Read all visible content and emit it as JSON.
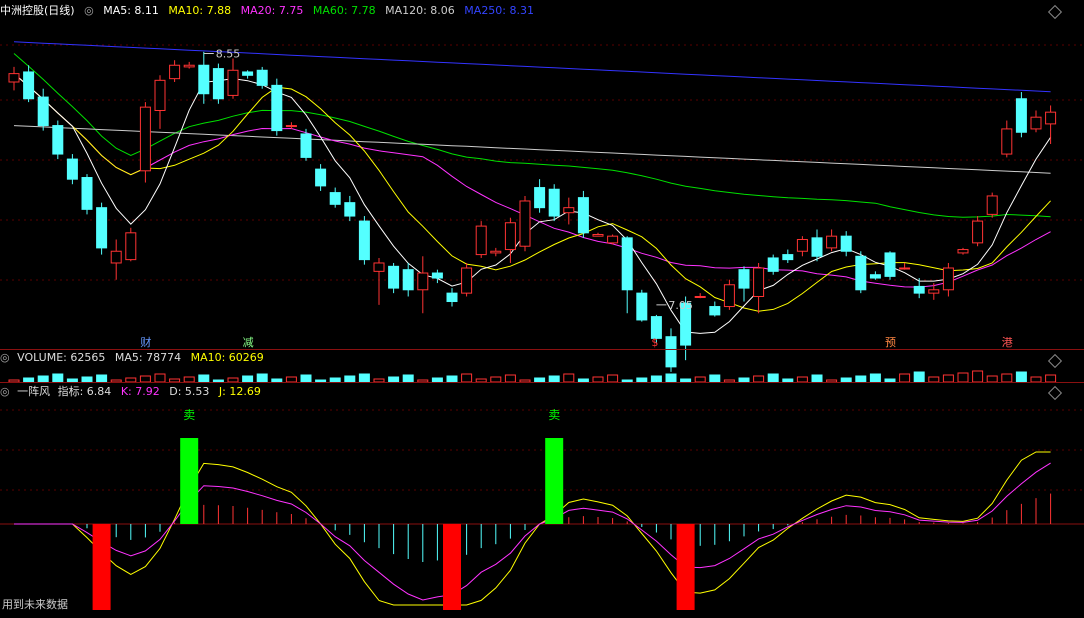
{
  "header": {
    "stock_name": "中洲控股",
    "period": "(日线)",
    "ma5": "MA5: 8.11",
    "ma10": "MA10: 7.88",
    "ma20": "MA20: 7.75",
    "ma60": "MA60: 7.78",
    "ma120": "MA120: 8.06",
    "ma250": "MA250: 8.31"
  },
  "volume_header": {
    "label": "VOLUME: 62565",
    "ma5": "MA5: 78774",
    "ma10": "MA10: 60269"
  },
  "indicator_header": {
    "name": "一阵风",
    "zhibiao": "指标: 6.84",
    "k": "K: 7.92",
    "d": "D: 5.53",
    "j": "J: 12.69"
  },
  "footer": {
    "text": "用到未来数据"
  },
  "colors": {
    "up": "#ff3333",
    "down": "#54ffff",
    "ma5": "#ffffff",
    "ma10": "#ffff00",
    "ma20": "#ff33ff",
    "ma60": "#00e000",
    "ma120": "#cccccc",
    "ma250": "#3333ff",
    "buy_bar": "#ff0000",
    "sell_bar": "#00ff00"
  },
  "chart_data": {
    "type": "candlestick",
    "price_range": [
      6.9,
      8.75
    ],
    "grid": true,
    "price_annotations": [
      {
        "index": 13,
        "value": 8.55,
        "label": "8.55"
      },
      {
        "index": 44,
        "value": 7.05,
        "label": "7.05"
      }
    ],
    "event_markers": [
      {
        "index": 9,
        "text": "财",
        "color": "#6699ff"
      },
      {
        "index": 16,
        "text": "减",
        "color": "#88ff88"
      },
      {
        "index": 44,
        "text": "$",
        "color": "#ff3333"
      },
      {
        "index": 60,
        "text": "预",
        "color": "#ff8844"
      },
      {
        "index": 68,
        "text": "港",
        "color": "#ff5555"
      }
    ],
    "candles": [
      [
        8.38,
        8.47,
        8.33,
        8.43
      ],
      [
        8.44,
        8.48,
        8.26,
        8.28
      ],
      [
        8.29,
        8.34,
        8.09,
        8.12
      ],
      [
        8.12,
        8.15,
        7.92,
        7.95
      ],
      [
        7.92,
        7.95,
        7.77,
        7.8
      ],
      [
        7.81,
        7.83,
        7.59,
        7.62
      ],
      [
        7.63,
        7.66,
        7.35,
        7.39
      ],
      [
        7.3,
        7.44,
        7.2,
        7.37
      ],
      [
        7.32,
        7.51,
        7.31,
        7.48
      ],
      [
        7.85,
        8.26,
        7.78,
        8.23
      ],
      [
        8.21,
        8.42,
        8.1,
        8.39
      ],
      [
        8.4,
        8.51,
        8.38,
        8.48
      ],
      [
        8.47,
        8.5,
        8.46,
        8.48
      ],
      [
        8.48,
        8.56,
        8.25,
        8.31
      ],
      [
        8.46,
        8.49,
        8.25,
        8.28
      ],
      [
        8.3,
        8.52,
        8.28,
        8.45
      ],
      [
        8.44,
        8.45,
        8.4,
        8.42
      ],
      [
        8.45,
        8.47,
        8.34,
        8.36
      ],
      [
        8.36,
        8.4,
        8.06,
        8.09
      ],
      [
        8.12,
        8.14,
        8.1,
        8.12
      ],
      [
        8.07,
        8.1,
        7.91,
        7.93
      ],
      [
        7.86,
        7.89,
        7.73,
        7.76
      ],
      [
        7.72,
        7.75,
        7.63,
        7.65
      ],
      [
        7.66,
        7.7,
        7.55,
        7.58
      ],
      [
        7.55,
        7.58,
        7.29,
        7.32
      ],
      [
        7.25,
        7.33,
        7.05,
        7.3
      ],
      [
        7.28,
        7.3,
        7.12,
        7.15
      ],
      [
        7.26,
        7.3,
        7.1,
        7.14
      ],
      [
        7.14,
        7.34,
        7.0,
        7.24
      ],
      [
        7.24,
        7.26,
        7.18,
        7.21
      ],
      [
        7.12,
        7.15,
        7.04,
        7.07
      ],
      [
        7.12,
        7.3,
        7.1,
        7.27
      ],
      [
        7.35,
        7.55,
        7.33,
        7.52
      ],
      [
        7.36,
        7.39,
        7.34,
        7.37
      ],
      [
        7.38,
        7.57,
        7.3,
        7.54
      ],
      [
        7.4,
        7.7,
        7.37,
        7.67
      ],
      [
        7.75,
        7.8,
        7.6,
        7.63
      ],
      [
        7.74,
        7.77,
        7.55,
        7.58
      ],
      [
        7.6,
        7.69,
        7.53,
        7.63
      ],
      [
        7.69,
        7.73,
        7.45,
        7.48
      ],
      [
        7.46,
        7.48,
        7.46,
        7.47
      ],
      [
        7.42,
        7.47,
        7.41,
        7.46
      ],
      [
        7.45,
        7.46,
        7.0,
        7.14
      ],
      [
        7.12,
        7.14,
        6.95,
        6.96
      ],
      [
        6.98,
        6.99,
        6.82,
        6.85
      ],
      [
        6.86,
        6.91,
        6.65,
        6.68
      ],
      [
        7.06,
        7.1,
        6.72,
        6.81
      ],
      [
        7.1,
        7.12,
        7.09,
        7.1
      ],
      [
        7.04,
        7.07,
        6.98,
        6.99
      ],
      [
        7.04,
        7.2,
        7.02,
        7.17
      ],
      [
        7.26,
        7.28,
        7.07,
        7.15
      ],
      [
        7.1,
        7.3,
        7.0,
        7.27
      ],
      [
        7.33,
        7.35,
        7.23,
        7.25
      ],
      [
        7.35,
        7.38,
        7.3,
        7.32
      ],
      [
        7.37,
        7.46,
        7.34,
        7.44
      ],
      [
        7.45,
        7.5,
        7.31,
        7.34
      ],
      [
        7.39,
        7.5,
        7.37,
        7.46
      ],
      [
        7.46,
        7.49,
        7.34,
        7.37
      ],
      [
        7.34,
        7.37,
        7.12,
        7.14
      ],
      [
        7.23,
        7.25,
        7.2,
        7.21
      ],
      [
        7.36,
        7.37,
        7.2,
        7.22
      ],
      [
        7.27,
        7.3,
        7.26,
        7.27
      ],
      [
        7.16,
        7.21,
        7.09,
        7.12
      ],
      [
        7.12,
        7.18,
        7.08,
        7.14
      ],
      [
        7.14,
        7.3,
        7.1,
        7.27
      ],
      [
        7.36,
        7.39,
        7.35,
        7.38
      ],
      [
        7.42,
        7.58,
        7.4,
        7.55
      ],
      [
        7.59,
        7.72,
        7.57,
        7.7
      ],
      [
        7.95,
        8.15,
        7.93,
        8.1
      ],
      [
        8.28,
        8.32,
        8.05,
        8.08
      ],
      [
        8.1,
        8.21,
        8.08,
        8.17
      ],
      [
        8.13,
        8.24,
        8.01,
        8.2
      ]
    ],
    "indicator": {
      "name": "一阵风",
      "signals": [
        {
          "type": "sell",
          "index": 12,
          "label": "卖"
        },
        {
          "type": "buy",
          "index": 6
        },
        {
          "type": "sell",
          "index": 37,
          "label": "卖"
        },
        {
          "type": "buy",
          "index": 30
        },
        {
          "type": "buy",
          "index": 46
        }
      ]
    }
  }
}
